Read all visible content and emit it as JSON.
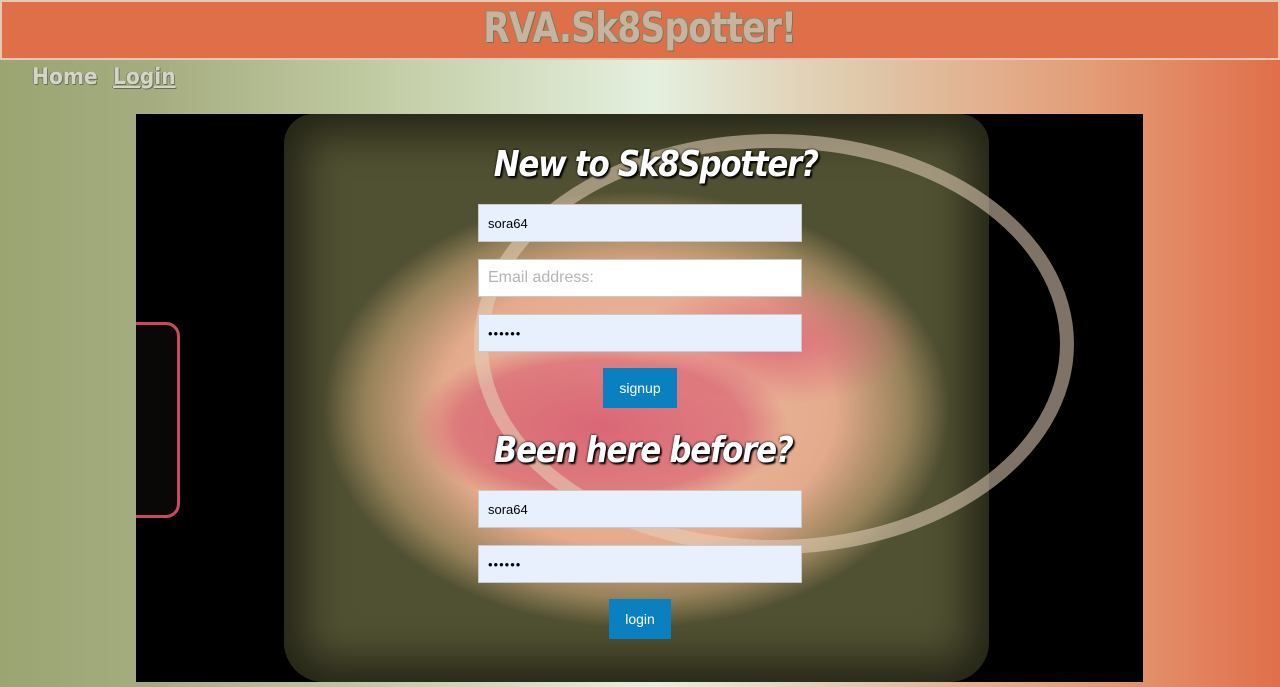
{
  "header": {
    "title": "RVA.Sk8Spotter!"
  },
  "nav": {
    "home_label": "Home",
    "login_label": "Login"
  },
  "signup": {
    "heading": "New to Sk8Spotter?",
    "username_value": "sora64",
    "email_placeholder": "Email address:",
    "password_value": "••••••",
    "button_label": "signup"
  },
  "login": {
    "heading": "Been here before?",
    "username_value": "sora64",
    "password_value": "••••••",
    "button_label": "login"
  },
  "colors": {
    "header_bg": "#df6f48",
    "button_bg": "#0b80c0",
    "autofill_bg": "#e8f0fe"
  }
}
